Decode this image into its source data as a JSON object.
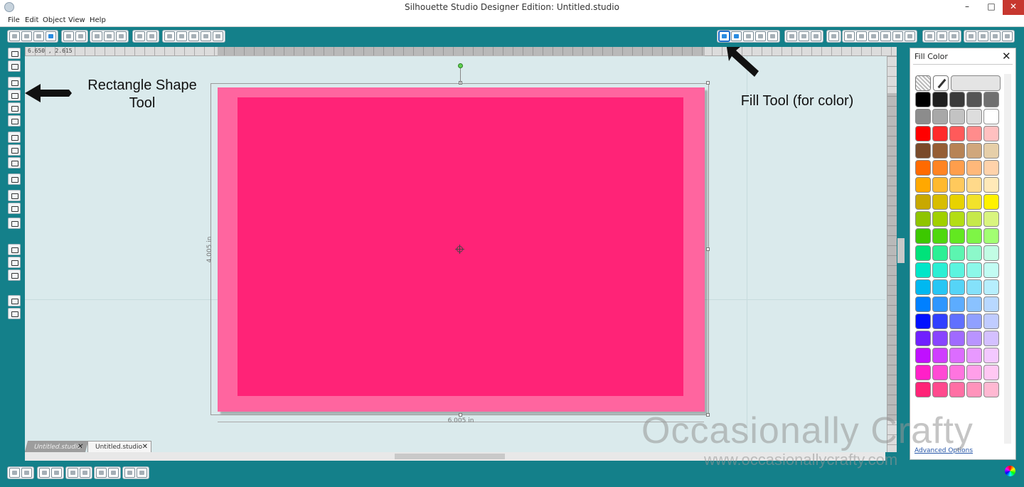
{
  "window": {
    "title": "Silhouette Studio Designer Edition: Untitled.studio",
    "minimize_label": "–",
    "maximize_label": "□",
    "close_label": "✕"
  },
  "menu": {
    "items": [
      {
        "label": "File"
      },
      {
        "label": "Edit"
      },
      {
        "label": "Object"
      },
      {
        "label": "View"
      },
      {
        "label": "Help"
      }
    ]
  },
  "workspace": {
    "coord_readout": "6.650 , 2.615",
    "width_dimension": "6.005 in",
    "height_dimension": "4.005 in"
  },
  "design": {
    "outer_color": "#ff659f",
    "inner_color": "#ff2377"
  },
  "annotations": {
    "rectangle_tool": "Rectangle Shape Tool",
    "fill_tool": "Fill Tool (for color)"
  },
  "doc_tabs": [
    {
      "label": "Untitled.studio"
    },
    {
      "label": "Untitled.studio"
    }
  ],
  "fill_panel": {
    "title": "Fill Color",
    "advanced_options": "Advanced Options",
    "palette": [
      [
        "#000000",
        "#1e1e1e",
        "#3a3a3a",
        "#555555",
        "#707070"
      ],
      [
        "#8c8c8c",
        "#a8a8a8",
        "#c3c3c3",
        "#dddddd",
        "#ffffff"
      ],
      [
        "#ff0000",
        "#ff2a2a",
        "#ff5a5a",
        "#ff8c8c",
        "#ffc0c0"
      ],
      [
        "#7a4a2a",
        "#955e35",
        "#b78355",
        "#d0a77c",
        "#e6cfa9"
      ],
      [
        "#ff6a00",
        "#ff8422",
        "#ff9e4c",
        "#ffb87a",
        "#ffd2aa"
      ],
      [
        "#ffa800",
        "#ffb92e",
        "#ffc95c",
        "#ffd98a",
        "#ffe9b8"
      ],
      [
        "#c8a800",
        "#d8bd00",
        "#e8d200",
        "#f2e22a",
        "#fff200"
      ],
      [
        "#8fc400",
        "#a1d000",
        "#b3dd15",
        "#c6e94a",
        "#d9f47f"
      ],
      [
        "#3cc800",
        "#4fd80e",
        "#62e820",
        "#7ef546",
        "#a2ff72"
      ],
      [
        "#00e27a",
        "#2cf095",
        "#5cf5b0",
        "#8cf8ca",
        "#c2fce4"
      ],
      [
        "#00e6c8",
        "#2cefd4",
        "#5cf4df",
        "#8cf8e9",
        "#c2fcf3"
      ],
      [
        "#00b8f0",
        "#27c6f4",
        "#55d4f7",
        "#84e1fa",
        "#b6eefd"
      ],
      [
        "#0080ff",
        "#2e96ff",
        "#5cacff",
        "#8ac2ff",
        "#b8d8ff"
      ],
      [
        "#0010ff",
        "#3040ff",
        "#6070ff",
        "#90a0ff",
        "#c0ccff"
      ],
      [
        "#7020ff",
        "#8844ff",
        "#a06aff",
        "#b994ff",
        "#d4c0ff"
      ],
      [
        "#c010ff",
        "#cf3eff",
        "#dc6cff",
        "#e899ff",
        "#f3c8ff"
      ],
      [
        "#ff20c8",
        "#ff4ad4",
        "#ff74df",
        "#ff9fe9",
        "#ffc8f3"
      ],
      [
        "#ff2377",
        "#ff4a8e",
        "#ff6fa4",
        "#ff93bb",
        "#ffb8d2"
      ]
    ]
  },
  "watermark": {
    "main": "Occasionally Crafty",
    "url": "www.occasionallycrafty.com"
  }
}
